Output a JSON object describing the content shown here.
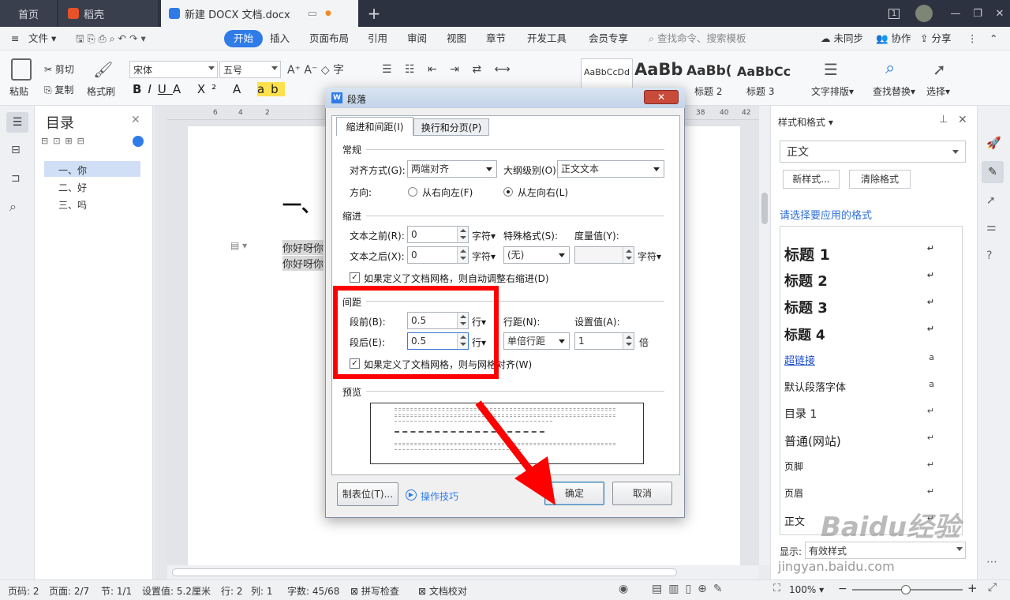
{
  "tabs": {
    "home": "首页",
    "daoke": "稻壳",
    "doc": "新建 DOCX 文档.docx"
  },
  "window": {
    "badge": "1"
  },
  "menu": {
    "file": "文件",
    "start": "开始",
    "insert": "插入",
    "layout": "页面布局",
    "reference": "引用",
    "review": "审阅",
    "view": "视图",
    "section": "章节",
    "dev": "开发工具",
    "vip": "会员专享",
    "search": "查找命令、搜索模板",
    "sync": "未同步",
    "collab": "协作",
    "share": "分享"
  },
  "ribbon": {
    "paste": "粘贴",
    "cut": "剪切",
    "copy": "复制",
    "formatpainter": "格式刷",
    "font": "宋体",
    "size": "五号",
    "style1": "AaBbCcDd",
    "style2": "AaBb",
    "style3": "AaBb(",
    "style4": "AaBbCc",
    "style3_name": "标题 2",
    "style4_name": "标题 3",
    "textlayout": "文字排版",
    "findreplace": "查找替换",
    "select": "选择"
  },
  "toc": {
    "title": "目录",
    "items": [
      "一、你",
      "二、好",
      "三、吗"
    ]
  },
  "ruler": {
    "nums": [
      "6",
      "4",
      "2",
      "38",
      "40",
      "42"
    ]
  },
  "doc": {
    "heading": "一、",
    "line1": "你好呀你",
    "line2": "你好呀你"
  },
  "dialog": {
    "title": "段落",
    "tab1": "缩进和间距(I)",
    "tab2": "换行和分页(P)",
    "general": "常规",
    "align_lbl": "对齐方式(G):",
    "align_val": "两端对齐",
    "outline_lbl": "大纲级别(O):",
    "outline_val": "正文文本",
    "dir_lbl": "方向:",
    "rtl": "从右向左(F)",
    "ltr": "从左向右(L)",
    "indent": "缩进",
    "before_text_lbl": "文本之前(R):",
    "before_text_val": "0",
    "after_text_lbl": "文本之后(X):",
    "after_text_val": "0",
    "unit_char": "字符",
    "special_lbl": "特殊格式(S):",
    "special_val": "(无)",
    "measure_lbl": "度量值(Y):",
    "unit_char2": "字符",
    "auto_indent": "如果定义了文档网格，则自动调整右缩进(D)",
    "spacing": "间距",
    "before_lbl": "段前(B):",
    "before_val": "0.5",
    "after_lbl": "段后(E):",
    "after_val": "0.5",
    "unit_line": "行",
    "linesp_lbl": "行距(N):",
    "linesp_val": "单倍行距",
    "setval_lbl": "设置值(A):",
    "setval_val": "1",
    "unit_times": "倍",
    "grid_align": "如果定义了文档网格，则与网格对齐(W)",
    "preview": "预览",
    "tabs_btn": "制表位(T)...",
    "tips": "操作技巧",
    "ok": "确定",
    "cancel": "取消"
  },
  "styles": {
    "title": "样式和格式",
    "current": "正文",
    "new": "新样式...",
    "clear": "清除格式",
    "hint": "请选择要应用的格式",
    "items": [
      "标题 1",
      "标题 2",
      "标题 3",
      "标题 4",
      "超链接",
      "默认段落字体",
      "目录 1",
      "普通(网站)",
      "页脚",
      "页眉",
      "正文"
    ],
    "show_lbl": "显示:",
    "show_val": "有效样式"
  },
  "status": {
    "page": "页码: 2",
    "pages": "页面: 2/7",
    "section": "节: 1/1",
    "setting": "设置值: 5.2厘米",
    "row": "行: 2",
    "col": "列: 1",
    "words": "字数: 45/68",
    "spell": "拼写检查",
    "proof": "文档校对",
    "zoom": "100%"
  },
  "watermark": {
    "text1": "Baidu经验",
    "text2": "jingyan.baidu.com"
  },
  "colors": {
    "accent": "#2f7be8",
    "annotation": "#ff0000"
  }
}
